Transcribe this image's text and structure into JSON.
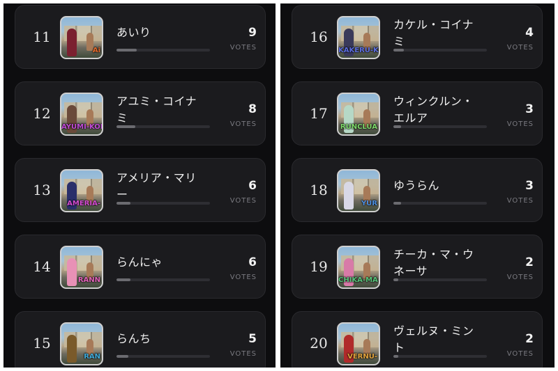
{
  "left": [
    {
      "rank": "11",
      "name": "あいり",
      "votes": "9",
      "votes_label": "VOTES",
      "fill": 0.22,
      "tag": "Ai",
      "tag_color": "#e36a2c",
      "fig_color": "#7b2030"
    },
    {
      "rank": "12",
      "name": "アユミ・コイナミ",
      "votes": "8",
      "votes_label": "VOTES",
      "fill": 0.2,
      "tag": "AYUMI-KOI",
      "tag_color": "#c04bd6",
      "fig_color": "#6a4a3a"
    },
    {
      "rank": "13",
      "name": "アメリア・マリー",
      "votes": "6",
      "votes_label": "VOTES",
      "fill": 0.15,
      "tag": "AMERIA-",
      "tag_color": "#d24cd0",
      "fig_color": "#2a2f6a"
    },
    {
      "rank": "14",
      "name": "らんにゃ",
      "votes": "6",
      "votes_label": "VOTES",
      "fill": 0.15,
      "tag": "RANN",
      "tag_color": "#e062b8",
      "fig_color": "#e891b6"
    },
    {
      "rank": "15",
      "name": "らんち",
      "votes": "5",
      "votes_label": "VOTES",
      "fill": 0.13,
      "tag": "RAN",
      "tag_color": "#3fa9d8",
      "fig_color": "#7a5a2a"
    }
  ],
  "right": [
    {
      "rank": "16",
      "name": "カケル・コイナミ",
      "votes": "4",
      "votes_label": "VOTES",
      "fill": 0.11,
      "tag": "KAKERU-KOI",
      "tag_color": "#5b6ee0",
      "fig_color": "#3a3a5a"
    },
    {
      "rank": "17",
      "name": "ウィンクルン・エルア",
      "votes": "3",
      "votes_label": "VOTES",
      "fill": 0.08,
      "tag": "RUNCLUA",
      "tag_color": "#7ed86a",
      "fig_color": "#b6d8c6"
    },
    {
      "rank": "18",
      "name": "ゆうらん",
      "votes": "3",
      "votes_label": "VOTES",
      "fill": 0.08,
      "tag": "YUR",
      "tag_color": "#4c8fe0",
      "fig_color": "#d8d8e6"
    },
    {
      "rank": "19",
      "name": "チーカ・マ・ウネーサ",
      "votes": "2",
      "votes_label": "VOTES",
      "fill": 0.05,
      "tag": "CHIKA-MA-UN",
      "tag_color": "#57c47a",
      "fig_color": "#d87aa8"
    },
    {
      "rank": "20",
      "name": "ヴェルヌ・ミント",
      "votes": "2",
      "votes_label": "VOTES",
      "fill": 0.05,
      "tag": "VERNU-",
      "tag_color": "#e0a23c",
      "fig_color": "#b02a2a"
    }
  ]
}
